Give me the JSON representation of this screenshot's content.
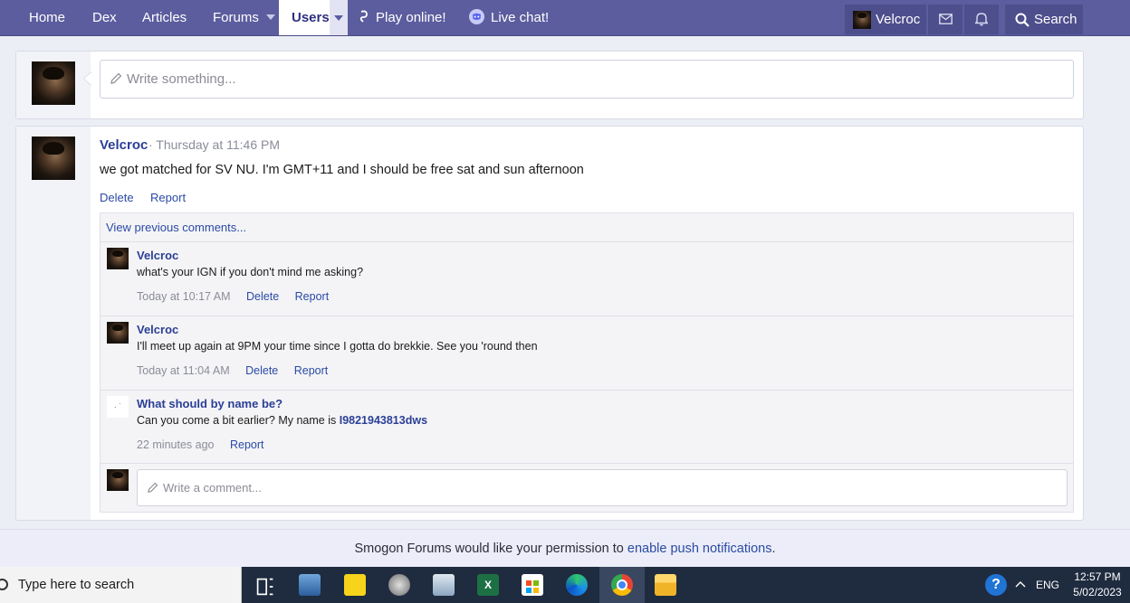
{
  "nav": {
    "tabs": [
      {
        "label": "Home"
      },
      {
        "label": "Dex"
      },
      {
        "label": "Articles"
      },
      {
        "label": "Forums"
      },
      {
        "label": "Users"
      },
      {
        "label": "Play online!"
      },
      {
        "label": "Live chat!"
      }
    ],
    "user_label": "Velcroc",
    "search_label": "Search"
  },
  "composer": {
    "placeholder": "Write something..."
  },
  "post": {
    "author": "Velcroc",
    "time": "· Thursday at 11:46 PM",
    "body": "we got matched for SV NU. I'm GMT+11 and I should be free sat and sun afternoon",
    "delete_label": "Delete",
    "report_label": "Report",
    "view_previous": "View previous comments...",
    "comments": [
      {
        "author": "Velcroc",
        "text": "what's your IGN if you don't mind me asking?",
        "time": "Today at 10:17 AM",
        "delete_label": "Delete",
        "report_label": "Report"
      },
      {
        "author": "Velcroc",
        "text": "I'll meet up again at 9PM your time since I gotta do brekkie. See you 'round then",
        "time": "Today at 11:04 AM",
        "delete_label": "Delete",
        "report_label": "Report"
      },
      {
        "author": "What should by name be?",
        "text": "Can you come a bit earlier? My name is",
        "mention": "I9821943813dws",
        "time": "22 minutes ago",
        "report_label": "Report"
      }
    ],
    "comment_placeholder": "Write a comment..."
  },
  "push_notice": {
    "text": "Smogon Forums would like your permission to",
    "link": "enable push notifications",
    "suffix": "."
  },
  "taskbar": {
    "search_placeholder": "Type here to search",
    "language": "ENG",
    "time": "12:57 PM",
    "date": "5/02/2023"
  },
  "colors": {
    "nav_bg": "#5c5d9e",
    "link": "#2b4aa5",
    "author": "#2b3f97",
    "taskbar_bg": "#1f2b3f"
  }
}
